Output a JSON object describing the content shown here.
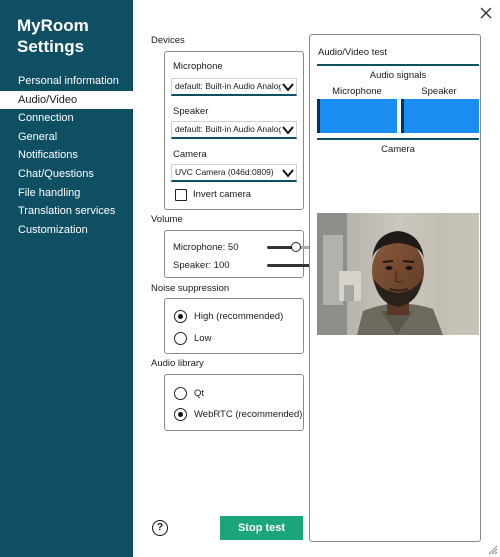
{
  "app": {
    "title": "MyRoom Settings"
  },
  "sidebar": {
    "items": [
      {
        "label": "Personal information",
        "active": false
      },
      {
        "label": "Audio/Video",
        "active": true
      },
      {
        "label": "Connection",
        "active": false
      },
      {
        "label": "General",
        "active": false
      },
      {
        "label": "Notifications",
        "active": false
      },
      {
        "label": "Chat/Questions",
        "active": false
      },
      {
        "label": "File handling",
        "active": false
      },
      {
        "label": "Translation services",
        "active": false
      },
      {
        "label": "Customization",
        "active": false
      }
    ]
  },
  "devices": {
    "section_label": "Devices",
    "microphone": {
      "label": "Microphone",
      "value": "default: Built-in Audio Analog Stereo"
    },
    "speaker": {
      "label": "Speaker",
      "value": "default: Built-in Audio Analog Stereo"
    },
    "camera": {
      "label": "Camera",
      "value": "UVC Camera (046d:0809)"
    },
    "invert_camera": {
      "label": "Invert camera",
      "checked": false
    }
  },
  "volume": {
    "section_label": "Volume",
    "microphone": {
      "label": "Microphone: 50",
      "value": 50
    },
    "speaker": {
      "label": "Speaker: 100",
      "value": 100
    }
  },
  "noise_suppression": {
    "section_label": "Noise suppression",
    "options": [
      {
        "label": "High (recommended)",
        "checked": true
      },
      {
        "label": "Low",
        "checked": false
      }
    ]
  },
  "audio_library": {
    "section_label": "Audio library",
    "options": [
      {
        "label": "Qt",
        "checked": false
      },
      {
        "label": "WebRTC (recommended)",
        "checked": true
      }
    ]
  },
  "test_panel": {
    "title": "Audio/Video test",
    "signals_label": "Audio signals",
    "mic_label": "Microphone",
    "speaker_label": "Speaker",
    "mic_level": 0.03,
    "speaker_level": 0.03,
    "camera_label": "Camera"
  },
  "actions": {
    "help": "?",
    "stop_test": "Stop test"
  },
  "colors": {
    "sidebar": "#0f4f63",
    "accent_button": "#1aa57c",
    "meter": "#1a8ef0",
    "meter_level": "#0a2e60"
  },
  "icons": {
    "close": "close-icon",
    "help": "help-icon",
    "caret": "chevron-down-icon",
    "grip": "resize-grip-icon"
  }
}
